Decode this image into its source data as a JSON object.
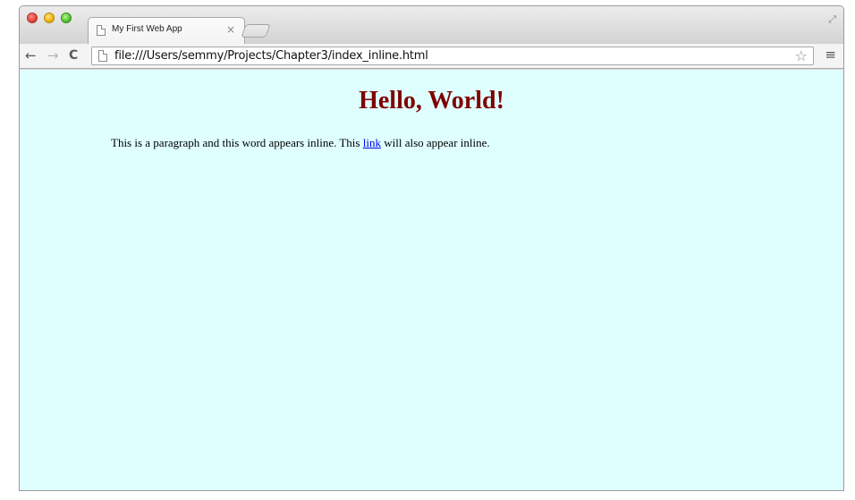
{
  "browser": {
    "tab": {
      "title": "My First Web App",
      "close_glyph": "×"
    },
    "toolbar": {
      "back_glyph": "←",
      "forward_glyph": "→",
      "reload_glyph": "C",
      "url": "file:///Users/semmy/Projects/Chapter3/index_inline.html",
      "star_glyph": "☆",
      "menu_glyph": "≡"
    },
    "fullscreen_glyph": "⤢"
  },
  "page": {
    "heading": "Hello, World!",
    "paragraph": {
      "before_link": "This is a paragraph and this word appears inline. This ",
      "link_text": "link",
      "after_link": " will also appear inline."
    },
    "colors": {
      "background": "#dfffff",
      "heading": "#800000",
      "link": "#0000ee"
    }
  }
}
